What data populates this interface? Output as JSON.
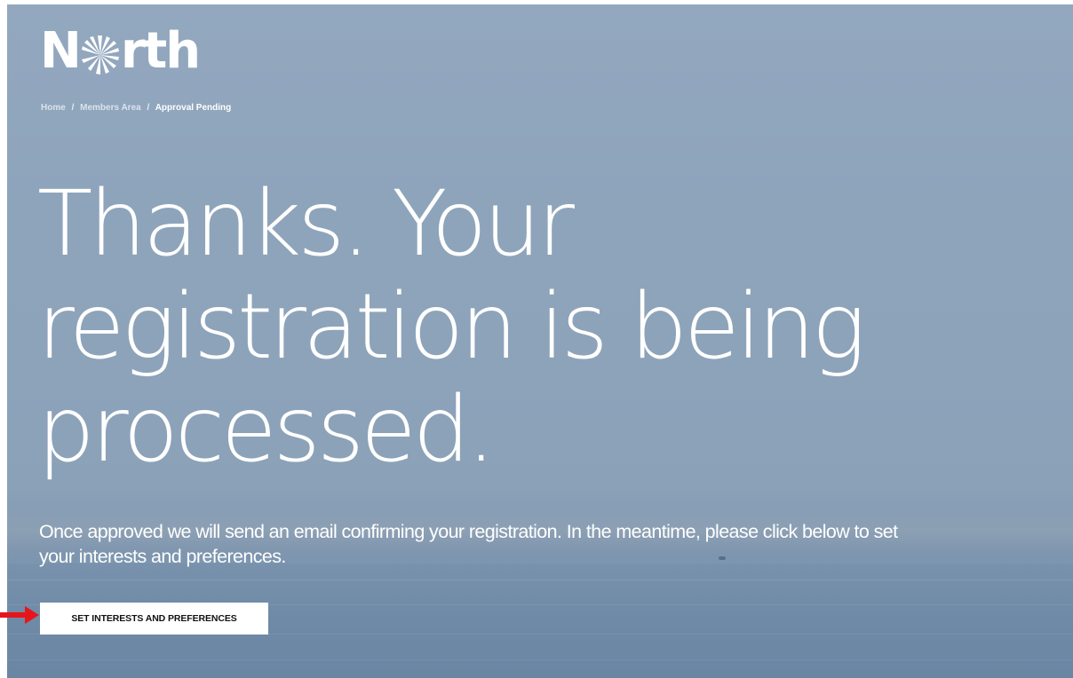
{
  "brand": {
    "logo_text_before": "N",
    "logo_text_after": "rth",
    "logo_text_full": "North"
  },
  "breadcrumb": {
    "items": [
      {
        "label": "Home"
      },
      {
        "label": "Members Area"
      },
      {
        "label": "Approval Pending"
      }
    ],
    "separator": "/"
  },
  "hero": {
    "headline_lines": [
      "Thanks. Your",
      "registration is being",
      "processed."
    ],
    "intro_lines": [
      "Once approved we will send an email confirming your registration. In the meantime, please click below to set",
      "your interests and preferences."
    ],
    "cta_label": "SET INTERESTS AND PREFERENCES"
  },
  "annotation": {
    "arrow_color": "#e8141c"
  },
  "colors": {
    "sky": "#8ea4bb",
    "sea": "#6f8aa6",
    "text": "#ffffff",
    "button_bg": "#ffffff",
    "button_text": "#111111"
  }
}
